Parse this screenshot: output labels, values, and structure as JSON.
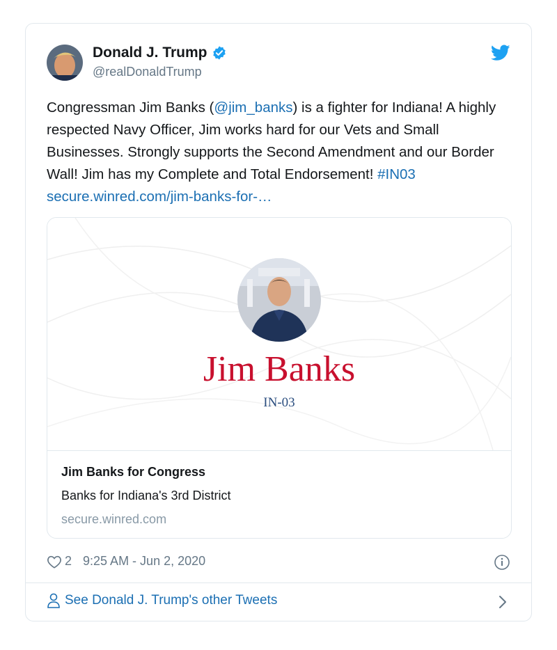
{
  "author": {
    "name": "Donald J. Trump",
    "handle": "@realDonaldTrump"
  },
  "tweet": {
    "text_1": "Congressman Jim Banks (",
    "mention": "@jim_banks",
    "text_2": ") is a fighter for Indiana! A highly respected Navy Officer, Jim works hard for our Vets and Small Businesses. Strongly supports the Second Amendment and our Border Wall! Jim has my Complete and Total Endorsement! ",
    "hashtag": "#IN03",
    "url": "secure.winred.com/jim-banks-for-…"
  },
  "card": {
    "big_title": "Jim Banks",
    "subtitle": "IN-03",
    "title": "Jim Banks for Congress",
    "description": "Banks for Indiana's 3rd District",
    "domain": "secure.winred.com"
  },
  "meta": {
    "likes": "2",
    "timestamp": "9:25 AM - Jun 2, 2020"
  },
  "footer": {
    "label": "See Donald J. Trump's other Tweets"
  },
  "icons": {
    "verified": "verified-badge-icon",
    "bird": "twitter-bird-icon",
    "heart": "heart-icon",
    "info": "info-icon",
    "person": "person-icon",
    "chevron": "chevron-right-icon"
  },
  "colors": {
    "link": "#1b6fb3",
    "verified": "#1da1f2",
    "card_title": "#c8102e",
    "card_subtitle": "#2a4d7e"
  }
}
